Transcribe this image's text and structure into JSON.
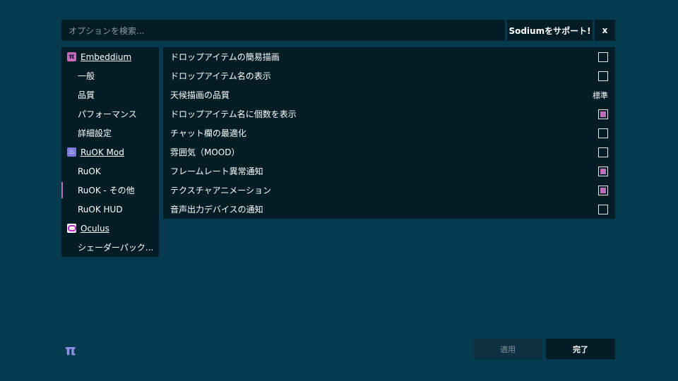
{
  "search": {
    "placeholder": "オプションを検索..."
  },
  "header": {
    "support_label": "Sodiumをサポート!",
    "close_label": "x"
  },
  "sidebar": {
    "items": [
      {
        "type": "mod",
        "label": "Embeddium",
        "icon": "pi-icon"
      },
      {
        "type": "sub",
        "label": "一般"
      },
      {
        "type": "sub",
        "label": "品質"
      },
      {
        "type": "sub",
        "label": "パフォーマンス"
      },
      {
        "type": "sub",
        "label": "詳細設定"
      },
      {
        "type": "mod",
        "label": "RuOK Mod",
        "icon": "ruok-icon"
      },
      {
        "type": "sub",
        "label": "RuOK"
      },
      {
        "type": "sub",
        "label": "RuOK - その他",
        "selected": true
      },
      {
        "type": "sub",
        "label": "RuOK HUD"
      },
      {
        "type": "mod",
        "label": "Oculus",
        "icon": "oculus-icon"
      },
      {
        "type": "sub",
        "label": "シェーダーパック..."
      }
    ]
  },
  "options": [
    {
      "label": "ドロップアイテムの簡易描画",
      "kind": "checkbox",
      "checked": false
    },
    {
      "label": "ドロップアイテム名の表示",
      "kind": "checkbox",
      "checked": false
    },
    {
      "label": "天候描画の品質",
      "kind": "value",
      "value": "標準"
    },
    {
      "label": "ドロップアイテム名に個数を表示",
      "kind": "checkbox",
      "checked": true
    },
    {
      "label": "チャット欄の最適化",
      "kind": "checkbox",
      "checked": false
    },
    {
      "label": "雰囲気（MOOD）",
      "kind": "checkbox",
      "checked": false
    },
    {
      "label": "フレームレート異常通知",
      "kind": "checkbox",
      "checked": true
    },
    {
      "label": "テクスチャアニメーション",
      "kind": "checkbox",
      "checked": true
    },
    {
      "label": "音声出力デバイスの通知",
      "kind": "checkbox",
      "checked": false
    }
  ],
  "footer": {
    "logo": "π",
    "apply_label": "適用",
    "done_label": "完了"
  },
  "colors": {
    "background": "#053a4f",
    "panel": "#031d26",
    "accent": "#c46bb9",
    "logo": "#8f8fe8"
  }
}
